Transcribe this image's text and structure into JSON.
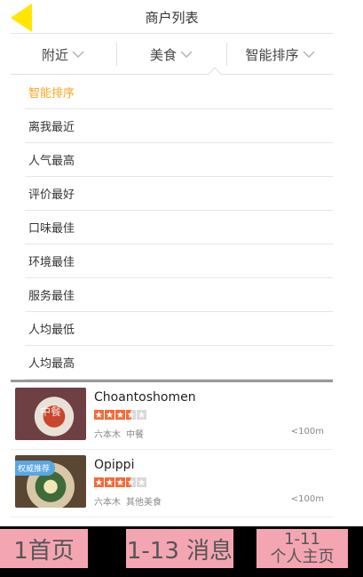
{
  "header": {
    "title": "商户列表",
    "back_icon": "back-arrow-icon",
    "back_color": "#ffe600"
  },
  "filters": [
    {
      "label": "附近",
      "icon": "chevron-down-icon"
    },
    {
      "label": "美食",
      "icon": "chevron-down-icon"
    },
    {
      "label": "智能排序",
      "icon": "chevron-down-icon"
    }
  ],
  "sort_options": {
    "selected": "智能排序",
    "accent_color": "#f5a623",
    "items": [
      "智能排序",
      "离我最近",
      "人气最高",
      "评价最好",
      "口味最佳",
      "环境最佳",
      "服务最佳",
      "人均最低",
      "人均最高"
    ]
  },
  "merchants": [
    {
      "name": "Choantoshomen",
      "rating": 3.5,
      "area": "六本木",
      "category": "中餐",
      "distance": "<100m",
      "thumb_text": "中餐",
      "badge": ""
    },
    {
      "name": "Opippi",
      "rating": 3.5,
      "area": "六本木",
      "category": "其他美食",
      "distance": "<100m",
      "thumb_text": "",
      "badge": "权威推荐"
    }
  ],
  "tabbar": {
    "tab1": {
      "label": "1首页"
    },
    "tab2": {
      "label": "1-13 消息"
    },
    "tab3": {
      "number": "1-11",
      "label": "个人主页"
    },
    "bg_color": "#f4a5b2"
  }
}
